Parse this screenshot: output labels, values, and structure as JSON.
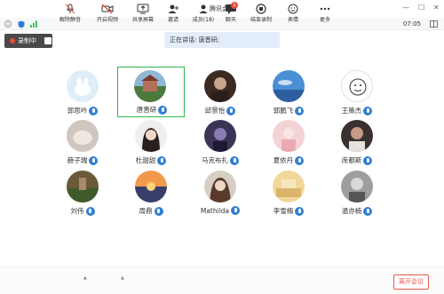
{
  "window": {
    "title": "腾讯会议",
    "min_glyph": "—",
    "max_glyph": "☐",
    "close_glyph": "✕"
  },
  "status": {
    "time": "07:05"
  },
  "recording": {
    "label": "录制中"
  },
  "speaking": {
    "text": "正在讲话: 唐晋研;"
  },
  "participants": [
    {
      "name": "郭思吟"
    },
    {
      "name": "唐晋研"
    },
    {
      "name": "邱景怡"
    },
    {
      "name": "郭鹏飞"
    },
    {
      "name": "王策杰"
    },
    {
      "name": "薛子瑞"
    },
    {
      "name": "杜甜甜"
    },
    {
      "name": "马克布扎"
    },
    {
      "name": "夏依丹"
    },
    {
      "name": "库都斯"
    },
    {
      "name": "刘伟"
    },
    {
      "name": "周鼎"
    },
    {
      "name": "Mathilda"
    },
    {
      "name": "李雪梅"
    },
    {
      "name": "温亦楠"
    }
  ],
  "toolbar": {
    "mute": "解除静音",
    "video": "开启视频",
    "share": "共享屏幕",
    "invite": "邀请",
    "members": "成员(18)",
    "chat": "聊天",
    "chat_badge": "1",
    "record": "结束录制",
    "emoji": "表情",
    "more": "更多",
    "leave": "离开会议"
  }
}
